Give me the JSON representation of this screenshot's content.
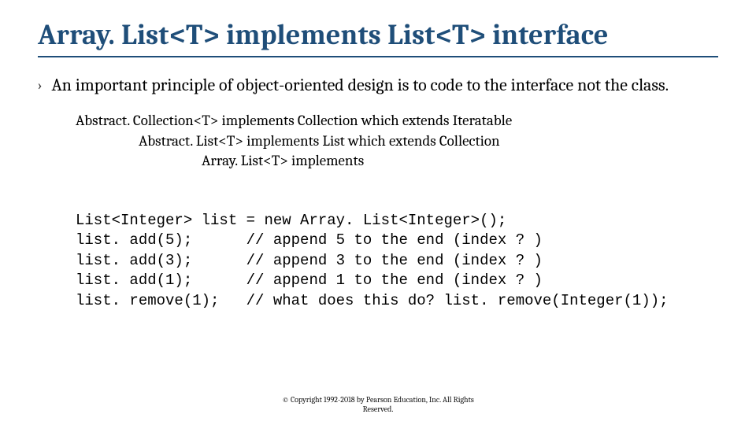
{
  "title": "Array. List<T> implements List<T> interface",
  "bullet_icon": "›",
  "principle": "An important principle of object-oriented design is to code to the interface not the class.",
  "hierarchy": {
    "line1": "Abstract. Collection<T> implements Collection which extends Iteratable",
    "line2": "Abstract. List<T> implements List which extends Collection",
    "line3": "Array. List<T> implements"
  },
  "code": {
    "line1": "List<Integer> list = new Array. List<Integer>();",
    "line2": "list. add(5);      // append 5 to the end (index ? )",
    "line3": "list. add(3);      // append 3 to the end (index ? )",
    "line4": "list. add(1);      // append 1 to the end (index ? )",
    "line5": "list. remove(1);   // what does this do? list. remove(Integer(1));"
  },
  "footer": {
    "line1": "© Copyright 1992-2018 by Pearson Education, Inc. All Rights",
    "line2": "Reserved."
  }
}
